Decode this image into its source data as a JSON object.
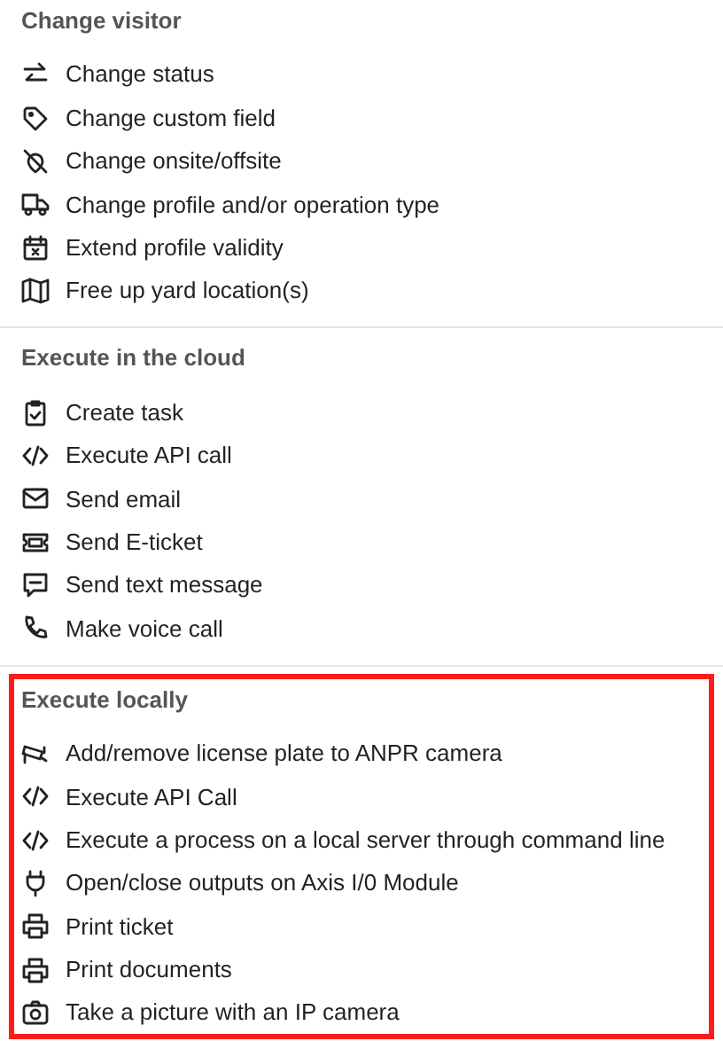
{
  "sections": [
    {
      "title": "Change visitor",
      "highlighted": false,
      "items": [
        {
          "label": "Change status",
          "kind": "swap"
        },
        {
          "label": "Change custom field",
          "kind": "tag"
        },
        {
          "label": "Change onsite/offsite",
          "kind": "pin-off"
        },
        {
          "label": "Change profile and/or operation type",
          "kind": "truck"
        },
        {
          "label": "Extend profile validity",
          "kind": "calendar-x"
        },
        {
          "label": "Free up yard location(s)",
          "kind": "map"
        }
      ]
    },
    {
      "title": "Execute in the cloud",
      "highlighted": false,
      "items": [
        {
          "label": "Create task",
          "kind": "clipboard"
        },
        {
          "label": "Execute API call",
          "kind": "code"
        },
        {
          "label": "Send email",
          "kind": "mail"
        },
        {
          "label": "Send E-ticket",
          "kind": "ticket"
        },
        {
          "label": "Send text message",
          "kind": "sms"
        },
        {
          "label": "Make voice call",
          "kind": "phone"
        }
      ]
    },
    {
      "title": "Execute locally",
      "highlighted": true,
      "items": [
        {
          "label": "Add/remove license plate to ANPR camera",
          "kind": "cctv"
        },
        {
          "label": "Execute API Call",
          "kind": "code"
        },
        {
          "label": "Execute a process on a local server through command line",
          "kind": "code"
        },
        {
          "label": "Open/close outputs on Axis I/0 Module",
          "kind": "plug"
        },
        {
          "label": "Print ticket",
          "kind": "printer"
        },
        {
          "label": "Print documents",
          "kind": "printer"
        },
        {
          "label": "Take a picture with an IP camera",
          "kind": "camera"
        }
      ]
    }
  ]
}
